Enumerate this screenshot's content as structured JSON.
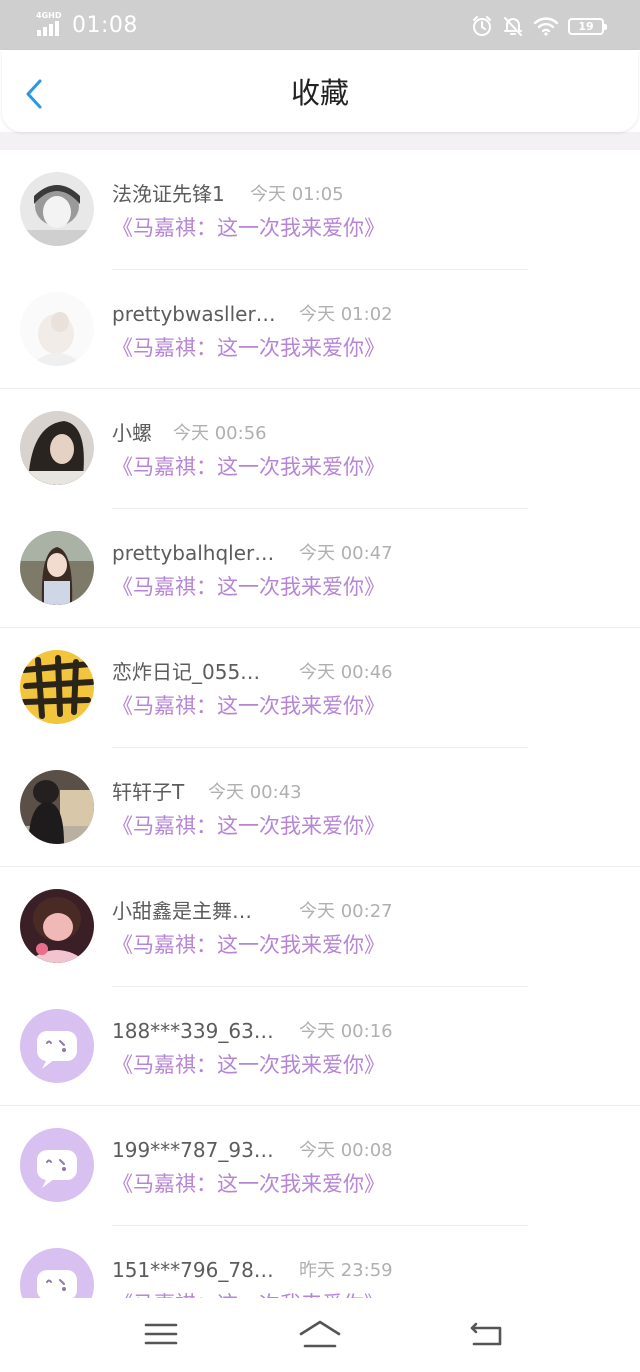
{
  "status_bar": {
    "network": "4GHD",
    "time": "01:08",
    "battery": "19",
    "icons": [
      "signal-icon",
      "alarm-icon",
      "mute-icon",
      "wifi-icon",
      "battery-icon"
    ]
  },
  "header": {
    "title": "收藏",
    "back_icon": "chevron-left-icon"
  },
  "favorites": [
    {
      "user": "法浼证先锋1",
      "time": "今天 01:05",
      "title": "《马嘉祺：这一次我来爱你》"
    },
    {
      "user": "prettybwasller…",
      "time": "今天 01:02",
      "title": "《马嘉祺：这一次我来爱你》"
    },
    {
      "user": "小螺",
      "time": "今天 00:56",
      "title": "《马嘉祺：这一次我来爱你》"
    },
    {
      "user": "prettybalhqler…",
      "time": "今天 00:47",
      "title": "《马嘉祺：这一次我来爱你》"
    },
    {
      "user": "恋炸日记_055…",
      "time": "今天 00:46",
      "title": "《马嘉祺：这一次我来爱你》"
    },
    {
      "user": "轩轩子T",
      "time": "今天 00:43",
      "title": "《马嘉祺：这一次我来爱你》"
    },
    {
      "user": "小甜鑫是主舞…",
      "time": "今天 00:27",
      "title": "《马嘉祺：这一次我来爱你》"
    },
    {
      "user": "188***339_63…",
      "time": "今天 00:16",
      "title": "《马嘉祺：这一次我来爱你》"
    },
    {
      "user": "199***787_93…",
      "time": "今天 00:08",
      "title": "《马嘉祺：这一次我来爱你》"
    },
    {
      "user": "151***796_78…",
      "time": "昨天 23:59",
      "title": "《马嘉祺：这一次我来爱你》"
    }
  ],
  "bottom_nav": {
    "icons": [
      "menu-icon",
      "home-icon",
      "back-icon"
    ]
  },
  "colors": {
    "status_bar": "#cfcfcf",
    "accent_blue": "#2a96e6",
    "title_purple": "#b685d6",
    "default_avatar": "#d8c0f0",
    "divider": "#ececec"
  }
}
